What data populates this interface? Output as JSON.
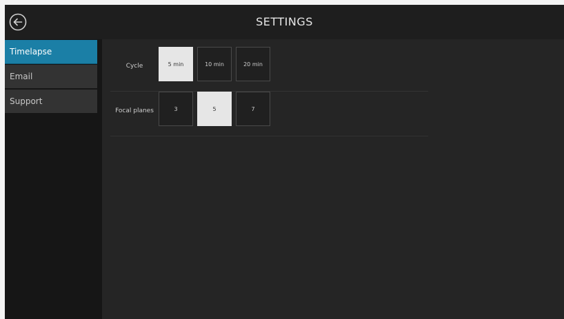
{
  "header": {
    "title": "SETTINGS",
    "back_icon": "back-arrow-circle-icon"
  },
  "sidebar": {
    "items": [
      {
        "label": "Timelapse",
        "active": true
      },
      {
        "label": "Email",
        "active": false
      },
      {
        "label": "Support",
        "active": false
      }
    ]
  },
  "settings": {
    "cycle": {
      "label": "Cycle",
      "options": [
        "5 min",
        "10 min",
        "20 min"
      ],
      "selected": "5 min"
    },
    "focal_planes": {
      "label": "Focal planes",
      "options": [
        "3",
        "5",
        "7"
      ],
      "selected": "5"
    }
  },
  "colors": {
    "accent": "#1b7fa6",
    "selected_option": "#e6e6e6",
    "background": "#252525"
  }
}
